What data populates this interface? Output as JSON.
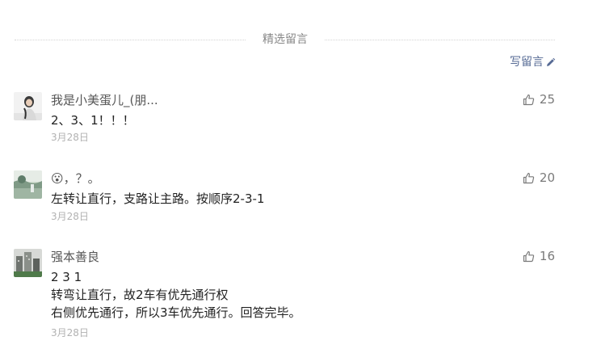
{
  "section": {
    "title": "精选留言"
  },
  "write_comment": {
    "label": "写留言",
    "icon": "pencil-icon"
  },
  "comments": [
    {
      "nickname": "我是小美蛋儿_(朋...",
      "lines": [
        "2、3、1！！！"
      ],
      "date": "3月28日",
      "likes": "25",
      "avatar": "girl-photo-avatar"
    },
    {
      "nickname": "😮，？。",
      "lines": [
        "左转让直行，支路让主路。按顺序2-3-1"
      ],
      "date": "3月28日",
      "likes": "20",
      "avatar": "landscape-photo-avatar"
    },
    {
      "nickname": "强本善良",
      "lines": [
        "2 3 1",
        "转弯让直行，故2车有优先通行权",
        "右侧优先通行，所以3车优先通行。回答完毕。"
      ],
      "date": "3月28日",
      "likes": "16",
      "avatar": "city-building-avatar"
    }
  ],
  "colors": {
    "link": "#576b95",
    "date": "#b2b2b2",
    "nickname": "#555555",
    "content": "#222222"
  }
}
